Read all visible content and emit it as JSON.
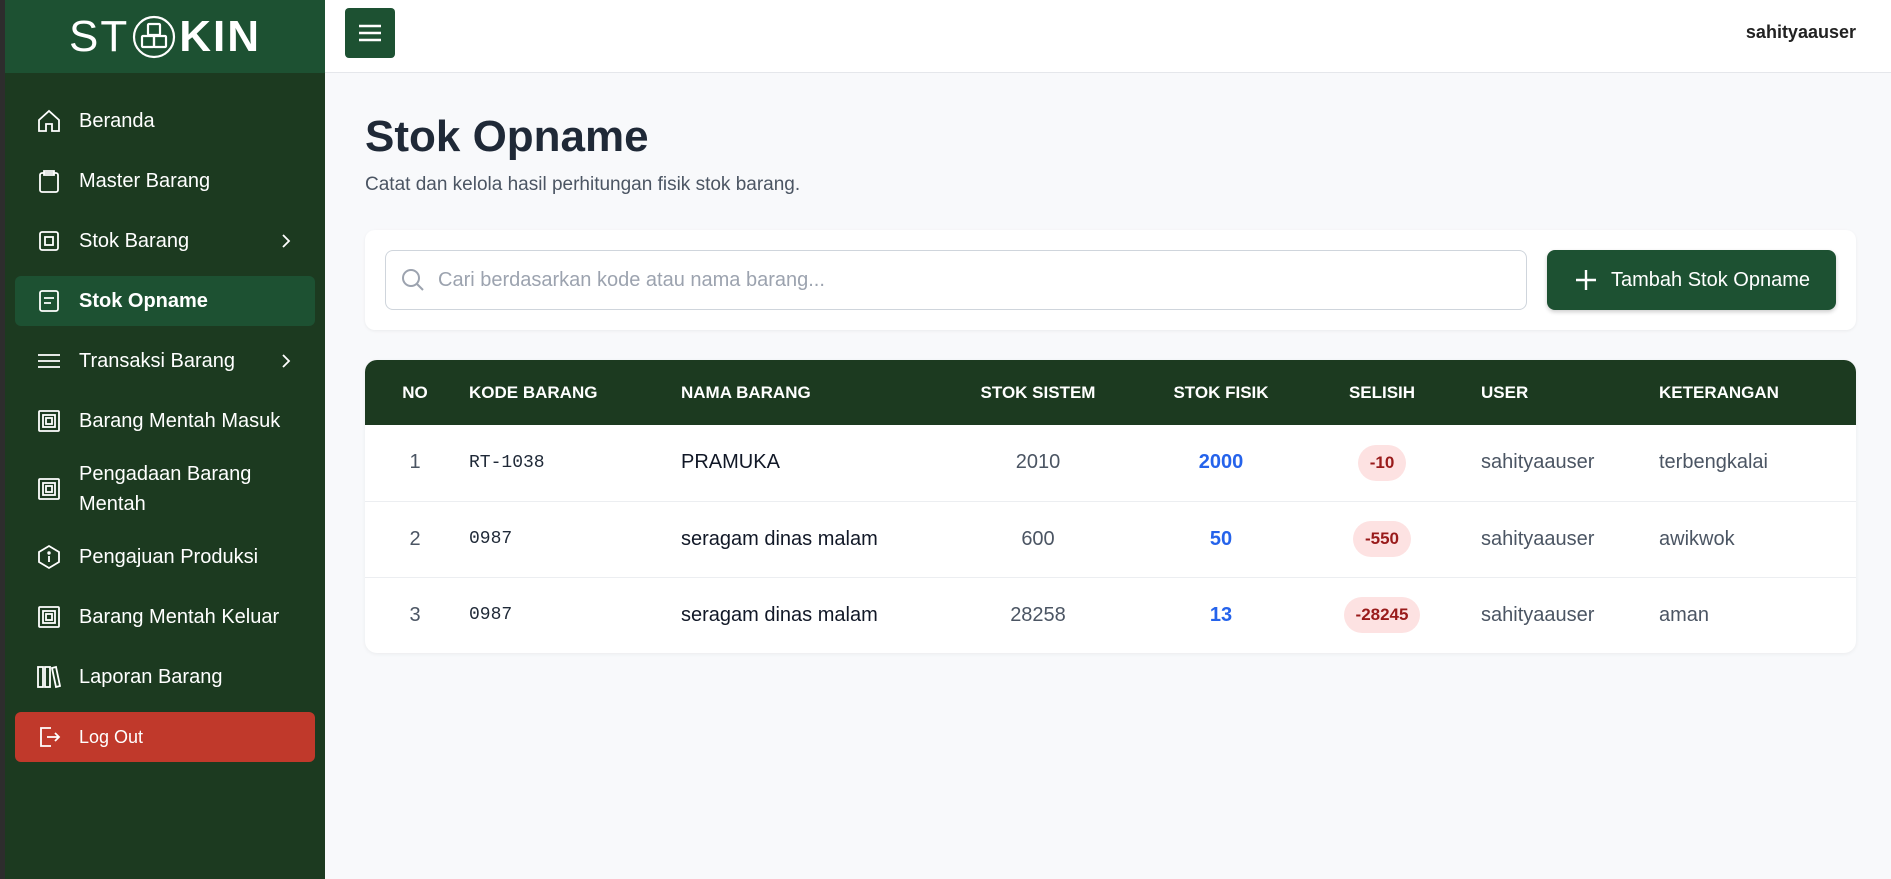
{
  "brand": {
    "part1": "ST",
    "part2": "K",
    "part3": "IN"
  },
  "topbar": {
    "username": "sahityaauser"
  },
  "sidebar": {
    "items": [
      {
        "label": "Beranda"
      },
      {
        "label": "Master Barang"
      },
      {
        "label": "Stok Barang"
      },
      {
        "label": "Stok Opname"
      },
      {
        "label": "Transaksi Barang"
      },
      {
        "label": "Barang Mentah Masuk"
      },
      {
        "label": "Pengadaan Barang Mentah"
      },
      {
        "label": "Pengajuan Produksi"
      },
      {
        "label": "Barang Mentah Keluar"
      },
      {
        "label": "Laporan Barang"
      }
    ],
    "logout": "Log Out"
  },
  "page": {
    "title": "Stok Opname",
    "subtitle": "Catat dan kelola hasil perhitungan fisik stok barang."
  },
  "search": {
    "placeholder": "Cari berdasarkan kode atau nama barang..."
  },
  "add_button": "Tambah Stok Opname",
  "table": {
    "headers": [
      "NO",
      "KODE BARANG",
      "NAMA BARANG",
      "STOK SISTEM",
      "STOK FISIK",
      "SELISIH",
      "USER",
      "KETERANGAN"
    ],
    "rows": [
      {
        "no": "1",
        "kode": "RT-1038",
        "nama": "PRAMUKA",
        "sistem": "2010",
        "fisik": "2000",
        "selisih": "-10",
        "user": "sahityaauser",
        "ket": "terbengkalai"
      },
      {
        "no": "2",
        "kode": "0987",
        "nama": "seragam dinas malam",
        "sistem": "600",
        "fisik": "50",
        "selisih": "-550",
        "user": "sahityaauser",
        "ket": "awikwok"
      },
      {
        "no": "3",
        "kode": "0987",
        "nama": "seragam dinas malam",
        "sistem": "28258",
        "fisik": "13",
        "selisih": "-28245",
        "user": "sahityaauser",
        "ket": "aman"
      }
    ]
  },
  "colors": {
    "sidebar": "#1c3a20",
    "brand": "#1d5132",
    "logout": "#c0392b",
    "accent_blue": "#2563eb"
  }
}
